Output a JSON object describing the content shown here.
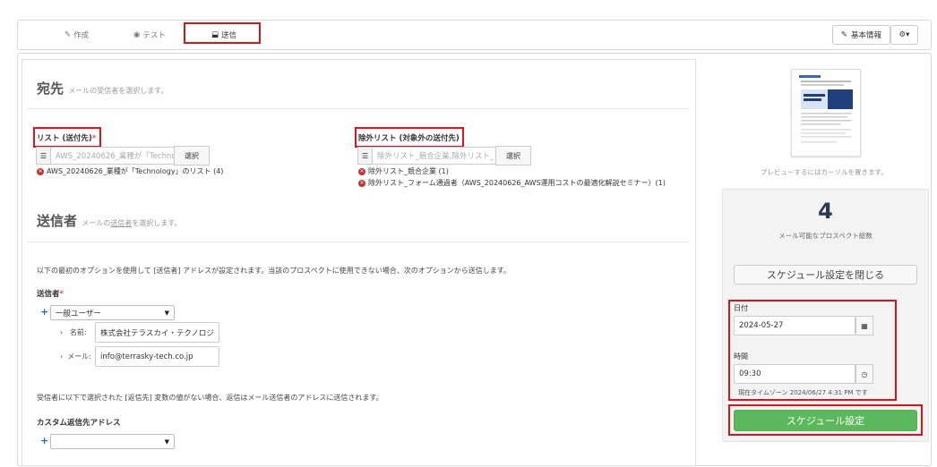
{
  "tabs": [
    {
      "label": "作成",
      "icon": "edit-icon"
    },
    {
      "label": "テスト",
      "icon": "target-icon"
    },
    {
      "label": "送信",
      "icon": "send-icon"
    }
  ],
  "header": {
    "basic_info_label": "基本情報"
  },
  "recipients": {
    "title": "宛先",
    "hint": "メールの受信者を選択します。",
    "list_label": "リスト (送付先)",
    "list_placeholder": "AWS_20240626_業種が「Techno",
    "select_label": "選択",
    "selected_lists": [
      "AWS_20240626_業種が「Technology」のリスト (4)"
    ],
    "exclude_label": "除外リスト (対象外の送付先)",
    "exclude_placeholder": "除外リスト_競合企業,除外リスト_",
    "excluded_lists": [
      "除外リスト_競合企業 (1)",
      "除外リスト_フォーム通過者（AWS_20240626_AWS運用コストの最適化解説セミナー）(1)"
    ]
  },
  "sender": {
    "title": "送信者",
    "hint_before": "メールの",
    "hint_link": "送信者",
    "hint_after": "を選択します。",
    "description": "以下の最初のオプションを使用して [送信者] アドレスが設定されます。当該のプロスペクトに使用できない場合、次のオプションから送信します。",
    "sender_label": "送信者",
    "sender_select": "一般ユーザー",
    "name_label": "名前:",
    "name_value": "株式会社テラスカイ・テクノロジ",
    "email_label": "メール:",
    "email_value": "info@terrasky-tech.co.jp",
    "reply_description": "受信者に以下で選択された [返信先] 変数の値がない場合、返信はメール送信者のアドレスに送信されます。",
    "reply_label": "カスタム返信先アドレス",
    "reply_select": ""
  },
  "preview": {
    "hint": "プレビューするにはカーソルを置きます。"
  },
  "schedule": {
    "count": "4",
    "count_label": "メール可能なプロスペクト総数",
    "close_button": "スケジュール設定を閉じる",
    "date_label": "日付",
    "date_value": "2024-05-27",
    "time_label": "時間",
    "time_value": "09:30",
    "timezone_text": "現在タイムゾーン 2024/06/27 4:31 PM です",
    "submit_button": "スケジュール設定"
  }
}
